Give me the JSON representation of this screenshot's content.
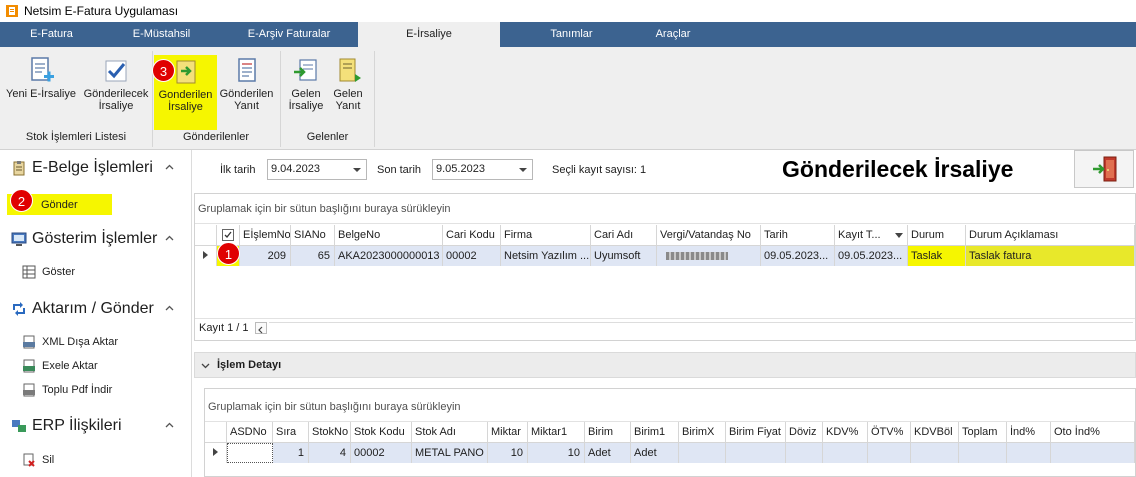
{
  "window": {
    "title": "Netsim E-Fatura Uygulaması"
  },
  "tabs": [
    {
      "label": "E-Fatura"
    },
    {
      "label": "E-Müstahsil"
    },
    {
      "label": "E-Arşiv Faturalar"
    },
    {
      "label": "E-İrsaliye"
    },
    {
      "label": "Tanımlar"
    },
    {
      "label": "Araçlar"
    }
  ],
  "ribbon": {
    "groups": [
      {
        "label": "Stok İşlemleri Listesi"
      },
      {
        "label": "Gönderilenler"
      },
      {
        "label": "Gelenler"
      }
    ],
    "buttons": [
      {
        "line1": "Yeni E-İrsaliye",
        "line2": ""
      },
      {
        "line1": "Gönderilecek",
        "line2": "İrsaliye"
      },
      {
        "line1": "Gonderilen",
        "line2": "İrsaliye"
      },
      {
        "line1": "Gönderilen",
        "line2": "Yanıt"
      },
      {
        "line1": "Gelen",
        "line2": "İrsaliye"
      },
      {
        "line1": "Gelen",
        "line2": "Yanıt"
      }
    ]
  },
  "sidebar": {
    "sections": [
      {
        "title": "E-Belge İşlemleri",
        "items": [
          {
            "label": "Gönder"
          }
        ]
      },
      {
        "title": "Gösterim İşlemler",
        "items": [
          {
            "label": "Göster"
          }
        ]
      },
      {
        "title": "Aktarım / Gönder",
        "items": [
          {
            "label": "XML Dışa Aktar"
          },
          {
            "label": "Exele Aktar"
          },
          {
            "label": "Toplu Pdf İndir"
          }
        ]
      },
      {
        "title": "ERP İlişkileri",
        "items": [
          {
            "label": "Sil"
          }
        ]
      }
    ]
  },
  "filters": {
    "start_label": "İlk tarih",
    "start_value": "9.04.2023",
    "end_label": "Son tarih",
    "end_value": "9.05.2023",
    "selected_count": "Seçli kayıt sayısı: 1"
  },
  "page_title": "Gönderilecek İrsaliye",
  "main_grid": {
    "group_hint": "Gruplamak için bir sütun başlığını buraya sürükleyin",
    "columns": [
      "EİşlemNo",
      "SIANo",
      "BelgeNo",
      "Cari Kodu",
      "Firma",
      "Cari Adı",
      "Vergi/Vatandaş No",
      "Tarih",
      "Kayıt T...",
      "Durum",
      "Durum Açıklaması"
    ],
    "row": {
      "checked": true,
      "cells": [
        "209",
        "65",
        "AKA2023000000013",
        "00002",
        "Netsim Yazılım ...",
        "Uyumsoft",
        "",
        "09.05.2023...",
        "09.05.2023...",
        "Taslak",
        "Taslak fatura"
      ]
    },
    "record": "Kayıt 1 / 1"
  },
  "detail": {
    "title": "İşlem Detayı",
    "group_hint": "Gruplamak için bir sütun başlığını buraya sürükleyin",
    "columns": [
      "ASDNo",
      "Sıra",
      "StokNo",
      "Stok Kodu",
      "Stok Adı",
      "Miktar",
      "Miktar1",
      "Birim",
      "Birim1",
      "BirimX",
      "Birim Fiyat",
      "Döviz",
      "KDV%",
      "ÖTV%",
      "KDVBöl",
      "Toplam",
      "İnd%",
      "Oto İnd%"
    ],
    "row": [
      "",
      "1",
      "4",
      "00002",
      "METAL PANO",
      "10",
      "10",
      "Adet",
      "Adet",
      "",
      "",
      "",
      "",
      "",
      "",
      "",
      "",
      ""
    ]
  },
  "badges": [
    "1",
    "2",
    "3"
  ],
  "colors": {
    "tabbar": "#3c6390",
    "highlight": "#f6f600",
    "badge": "#e00000",
    "selected_row": "#dfe6f4"
  }
}
